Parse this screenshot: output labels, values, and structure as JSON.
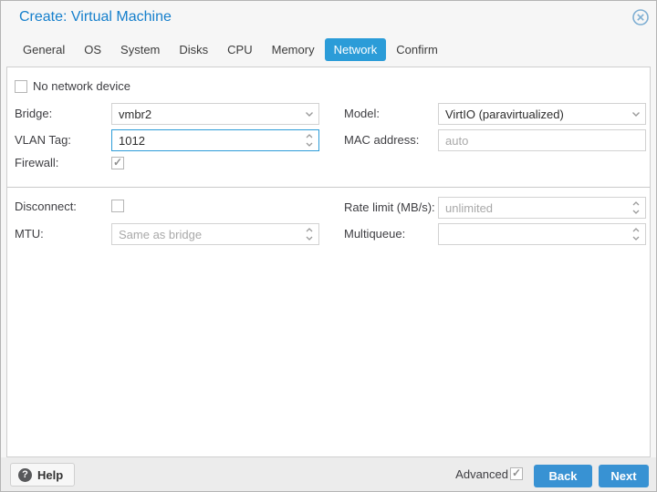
{
  "window": {
    "title": "Create: Virtual Machine"
  },
  "tabs": [
    {
      "label": "General",
      "active": false
    },
    {
      "label": "OS",
      "active": false
    },
    {
      "label": "System",
      "active": false
    },
    {
      "label": "Disks",
      "active": false
    },
    {
      "label": "CPU",
      "active": false
    },
    {
      "label": "Memory",
      "active": false
    },
    {
      "label": "Network",
      "active": true
    },
    {
      "label": "Confirm",
      "active": false
    }
  ],
  "form": {
    "no_network_device": {
      "label": "No network device",
      "checked": false
    },
    "bridge": {
      "label": "Bridge:",
      "value": "vmbr2",
      "type": "combobox"
    },
    "model": {
      "label": "Model:",
      "value": "VirtIO (paravirtualized)",
      "type": "combobox"
    },
    "vlan_tag": {
      "label": "VLAN Tag:",
      "value": "1012",
      "type": "spinner",
      "focused": true
    },
    "mac_address": {
      "label": "MAC address:",
      "value": "",
      "placeholder": "auto"
    },
    "firewall": {
      "label": "Firewall:",
      "checked": true
    },
    "disconnect": {
      "label": "Disconnect:",
      "checked": false
    },
    "rate_limit": {
      "label": "Rate limit (MB/s):",
      "value": "",
      "placeholder": "unlimited",
      "type": "spinner"
    },
    "mtu": {
      "label": "MTU:",
      "value": "",
      "placeholder": "Same as bridge",
      "type": "spinner"
    },
    "multiqueue": {
      "label": "Multiqueue:",
      "value": "",
      "placeholder": "",
      "type": "spinner"
    }
  },
  "footer": {
    "help_label": "Help",
    "advanced_label": "Advanced",
    "advanced_checked": true,
    "back_label": "Back",
    "next_label": "Next"
  },
  "colors": {
    "title": "#157fcc",
    "accent": "#2b9cd8",
    "btn": "#3892d3",
    "focus": "#2d9cd8"
  }
}
